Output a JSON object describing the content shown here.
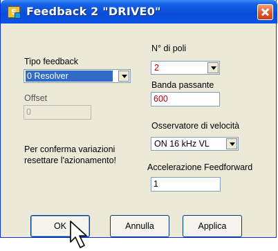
{
  "window": {
    "title": "Feedback 2 \"DRIVE0\""
  },
  "left": {
    "tipo_label": "Tipo feedback",
    "tipo_value": "0 Resolver",
    "offset_label": "Offset",
    "offset_value": "0",
    "note_line1": "Per conferma variazioni",
    "note_line2": "resettare l'azionamento!"
  },
  "right": {
    "poli_label": "N° di poli",
    "poli_value": "2",
    "banda_label": "Banda passante",
    "banda_value": "600",
    "oss_label": "Osservatore di velocità",
    "oss_value": "ON  16 kHz VL",
    "acc_label": "Accelerazione Feedforward",
    "acc_value": "1"
  },
  "buttons": {
    "ok": "OK",
    "annulla": "Annulla",
    "applica": "Applica"
  },
  "icons": {
    "app": "app-icon",
    "close": "close-icon",
    "cursor": "mouse-pointer-icon"
  }
}
